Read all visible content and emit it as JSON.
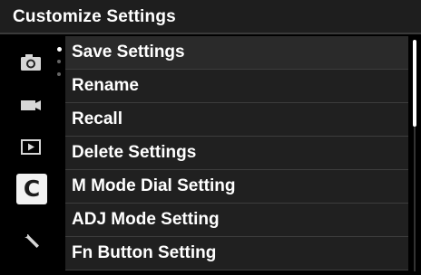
{
  "title": "Customize Settings",
  "side_tabs": [
    {
      "icon": "camera-icon",
      "active": false
    },
    {
      "icon": "video-camera-icon",
      "active": false
    },
    {
      "icon": "playback-icon",
      "active": false
    },
    {
      "icon": "custom-c-icon",
      "label": "C",
      "active": true
    },
    {
      "icon": "wrench-icon",
      "active": false
    }
  ],
  "menu_items": [
    {
      "label": "Save Settings",
      "selected": true
    },
    {
      "label": "Rename",
      "selected": false
    },
    {
      "label": "Recall",
      "selected": false
    },
    {
      "label": "Delete Settings",
      "selected": false
    },
    {
      "label": "M Mode Dial Setting",
      "selected": false
    },
    {
      "label": "ADJ Mode Setting",
      "selected": false
    },
    {
      "label": "Fn Button Setting",
      "selected": false
    }
  ],
  "colors": {
    "background": "#000000",
    "item_background": "#202020",
    "divider": "#3d3d3d",
    "text": "#ffffff",
    "active_tab": "#f2f2f2"
  }
}
